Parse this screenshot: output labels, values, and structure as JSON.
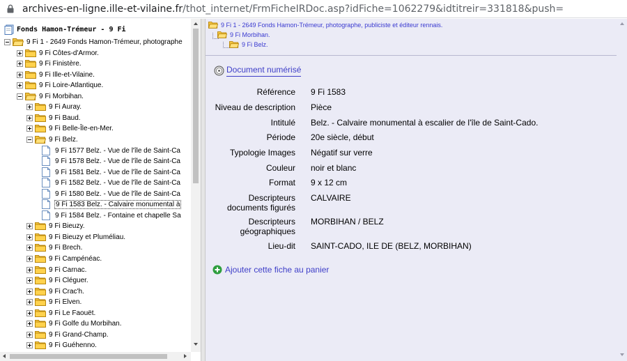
{
  "browser": {
    "url_host": "archives-en-ligne.ille-et-vilaine.fr",
    "url_path": "/thot_internet/FrmFicheIRDoc.asp?idFiche=1062279&idtitreir=331818&push="
  },
  "tree": {
    "root_label": "Fonds Hamon-Trémeur - 9 Fi",
    "items": [
      {
        "label": "9 Fi 1 - 2649 Fonds Hamon-Trémeur, photographe",
        "depth": 0,
        "state": "open"
      },
      {
        "label": "9 Fi Côtes-d'Armor.",
        "depth": 1,
        "state": "closed"
      },
      {
        "label": "9 Fi Finistère.",
        "depth": 1,
        "state": "closed"
      },
      {
        "label": "9 Fi Ille-et-Vilaine.",
        "depth": 1,
        "state": "closed"
      },
      {
        "label": "9 Fi Loire-Atlantique.",
        "depth": 1,
        "state": "closed"
      },
      {
        "label": "9 Fi Morbihan.",
        "depth": 1,
        "state": "open"
      },
      {
        "label": "9 Fi Auray.",
        "depth": 2,
        "state": "closed"
      },
      {
        "label": "9 Fi Baud.",
        "depth": 2,
        "state": "closed"
      },
      {
        "label": "9 Fi Belle-Île-en-Mer.",
        "depth": 2,
        "state": "closed"
      },
      {
        "label": "9 Fi Belz.",
        "depth": 2,
        "state": "open"
      },
      {
        "label": "9 Fi 1577 Belz. - Vue de l'île de Saint-Ca",
        "depth": 3,
        "state": "doc"
      },
      {
        "label": "9 Fi 1578 Belz. - Vue de l'île de Saint-Ca",
        "depth": 3,
        "state": "doc"
      },
      {
        "label": "9 Fi 1581 Belz. - Vue de l'île de Saint-Ca",
        "depth": 3,
        "state": "doc"
      },
      {
        "label": "9 Fi 1582 Belz. - Vue de l'île de Saint-Ca",
        "depth": 3,
        "state": "doc"
      },
      {
        "label": "9 Fi 1580 Belz. - Vue de l'île de Saint-Ca",
        "depth": 3,
        "state": "doc"
      },
      {
        "label": "9 Fi 1583 Belz. - Calvaire monumental à",
        "depth": 3,
        "state": "doc",
        "selected": true
      },
      {
        "label": "9 Fi 1584 Belz. - Fontaine et chapelle Sa",
        "depth": 3,
        "state": "doc"
      },
      {
        "label": "9 Fi Bieuzy.",
        "depth": 2,
        "state": "closed"
      },
      {
        "label": "9 Fi Bieuzy et Pluméliau.",
        "depth": 2,
        "state": "closed"
      },
      {
        "label": "9 Fi Brech.",
        "depth": 2,
        "state": "closed"
      },
      {
        "label": "9 Fi Campénéac.",
        "depth": 2,
        "state": "closed"
      },
      {
        "label": "9 Fi Carnac.",
        "depth": 2,
        "state": "closed"
      },
      {
        "label": "9 Fi Cléguer.",
        "depth": 2,
        "state": "closed"
      },
      {
        "label": "9 Fi Crac'h.",
        "depth": 2,
        "state": "closed"
      },
      {
        "label": "9 Fi Elven.",
        "depth": 2,
        "state": "closed"
      },
      {
        "label": "9 Fi Le Faouët.",
        "depth": 2,
        "state": "closed"
      },
      {
        "label": "9 Fi Golfe du Morbihan.",
        "depth": 2,
        "state": "closed"
      },
      {
        "label": "9 Fi Grand-Champ.",
        "depth": 2,
        "state": "closed"
      },
      {
        "label": "9 Fi Guéhenno.",
        "depth": 2,
        "state": "closed"
      }
    ]
  },
  "breadcrumb": [
    "9 Fi 1 - 2649 Fonds Hamon-Trémeur, photographe, publiciste et éditeur rennais.",
    "9 Fi Morbihan.",
    "9 Fi Belz."
  ],
  "document_link": "Document numérisé",
  "fields": [
    {
      "label": "Référence",
      "value": "9 Fi 1583"
    },
    {
      "label": "Niveau de description",
      "value": "Pièce"
    },
    {
      "label": "Intitulé",
      "value": "Belz. - Calvaire monumental à escalier de l'île de Saint-Cado."
    },
    {
      "label": "Période",
      "value": "20e siècle, début"
    },
    {
      "label": "Typologie Images",
      "value": "Négatif sur verre"
    },
    {
      "label": "Couleur",
      "value": "noir et blanc"
    },
    {
      "label": "Format",
      "value": "9 x 12 cm"
    },
    {
      "label_lines": [
        "Descripteurs",
        "documents figurés"
      ],
      "value": "CALVAIRE"
    },
    {
      "label_lines": [
        "Descripteurs",
        "géographiques"
      ],
      "value": "MORBIHAN / BELZ"
    },
    {
      "label": "Lieu-dit",
      "value": "SAINT-CADO, ILE DE (BELZ, MORBIHAN)"
    }
  ],
  "add_to_cart": "Ajouter cette fiche au panier",
  "colors": {
    "link": "#3e3ec8",
    "detail_bg": "#ebebf6",
    "folder": "#f4c542"
  }
}
